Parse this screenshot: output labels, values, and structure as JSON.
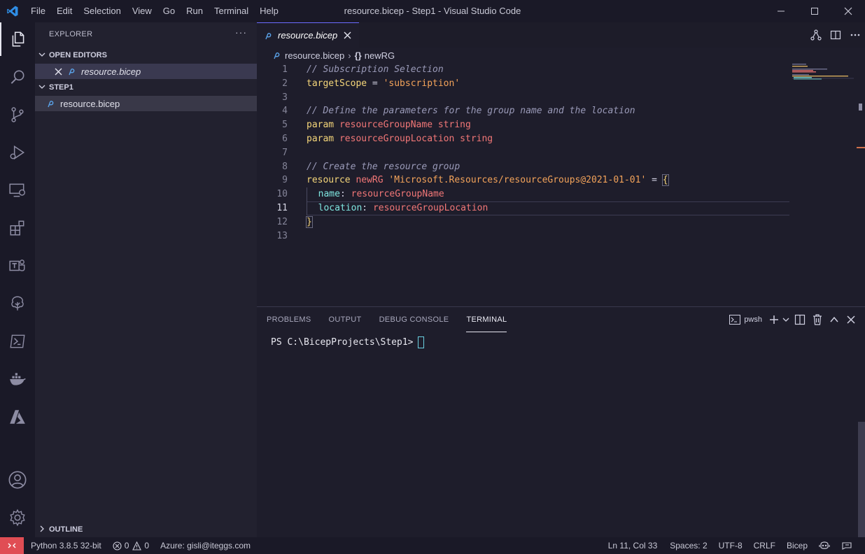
{
  "window": {
    "title": "resource.bicep - Step1 - Visual Studio Code",
    "menu": [
      "File",
      "Edit",
      "Selection",
      "View",
      "Go",
      "Run",
      "Terminal",
      "Help"
    ]
  },
  "activity_bar": {
    "items": [
      "explorer-icon",
      "search-icon",
      "source-control-icon",
      "run-debug-icon",
      "remote-explorer-icon",
      "extensions-icon",
      "teams-icon",
      "tree-icon",
      "powershell-icon",
      "docker-icon",
      "azure-icon",
      "account-icon",
      "settings-gear-icon"
    ]
  },
  "sidebar": {
    "title": "EXPLORER",
    "more": "···",
    "open_editors": {
      "label": "OPEN EDITORS",
      "files": [
        {
          "name": "resource.bicep"
        }
      ]
    },
    "folder": {
      "label": "STEP1",
      "files": [
        {
          "name": "resource.bicep"
        }
      ]
    },
    "outline": {
      "label": "OUTLINE"
    }
  },
  "editor": {
    "tab": {
      "label": "resource.bicep",
      "close": "✕"
    },
    "breadcrumb": {
      "file": "resource.bicep",
      "separator": "›",
      "symbol_icon": "{}",
      "symbol": "newRG"
    },
    "line_numbers": [
      "1",
      "2",
      "3",
      "4",
      "5",
      "6",
      "7",
      "8",
      "9",
      "10",
      "11",
      "12",
      "13"
    ],
    "current_line": 11,
    "code": {
      "l1": "// Subscription Selection",
      "l2_kw": "targetScope",
      "l2_op": " = ",
      "l2_str": "'subscription'",
      "l4": "// Define the parameters for the group name and the location",
      "l5_kw": "param",
      "l5_name": "resourceGroupName",
      "l5_type": "string",
      "l6_kw": "param",
      "l6_name": "resourceGroupLocation",
      "l6_type": "string",
      "l8": "// Create the resource group",
      "l9_kw": "resource",
      "l9_name": "newRG",
      "l9_str": "'Microsoft.Resources/resourceGroups@2021-01-01'",
      "l9_op": " = ",
      "l9_brace": "{",
      "l10_prop": "name",
      "l10_colon": ": ",
      "l10_val": "resourceGroupName",
      "l11_prop": "location",
      "l11_colon": ": ",
      "l11_val": "resourceGroupLocation",
      "l12_brace": "}"
    }
  },
  "panel": {
    "tabs": [
      "PROBLEMS",
      "OUTPUT",
      "DEBUG CONSOLE",
      "TERMINAL"
    ],
    "active_tab": "TERMINAL",
    "shell_label": "pwsh",
    "terminal_prompt": "PS C:\\BicepProjects\\Step1>"
  },
  "status_bar": {
    "python": "Python 3.8.5 32-bit",
    "errors": "0",
    "warnings": "0",
    "azure": "Azure: gisli@iteggs.com",
    "position": "Ln 11, Col 33",
    "spaces": "Spaces: 2",
    "encoding": "UTF-8",
    "eol": "CRLF",
    "language": "Bicep"
  },
  "colors": {
    "accent": "#6c6cff",
    "remote": "#e04d54",
    "keyword": "#f5d67a",
    "string": "#f3a35a",
    "type": "#f27777",
    "property": "#7fe6e0",
    "comment": "#9a9ab8"
  }
}
